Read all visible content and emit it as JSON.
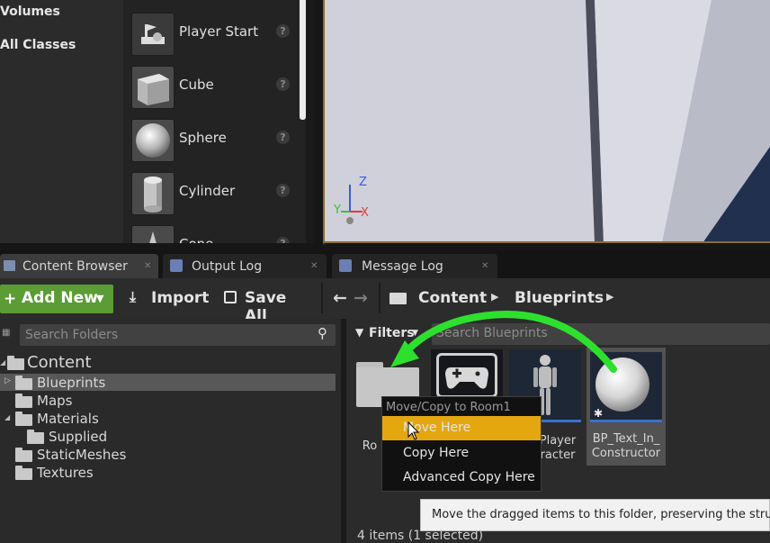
{
  "place_actors": {
    "categories": [
      "Volumes",
      "All Classes"
    ],
    "items": [
      {
        "label": "Player Start",
        "icon": "player-start-icon"
      },
      {
        "label": "Cube",
        "icon": "cube-icon"
      },
      {
        "label": "Sphere",
        "icon": "sphere-icon"
      },
      {
        "label": "Cylinder",
        "icon": "cylinder-icon"
      },
      {
        "label": "Cone",
        "icon": "cone-icon"
      }
    ],
    "help_glyph": "?"
  },
  "viewport": {
    "axis_z": "Z",
    "axis_y": "Y",
    "axis_x": "X"
  },
  "tabs": [
    {
      "label": "Content Browser",
      "icon": "content-browser-icon"
    },
    {
      "label": "Output Log",
      "icon": "output-log-icon"
    },
    {
      "label": "Message Log",
      "icon": "message-log-icon"
    }
  ],
  "toolbar": {
    "add_new_label": "Add New",
    "import_label": "Import",
    "save_all_label": "Save All",
    "breadcrumbs": [
      "Content",
      "Blueprints"
    ]
  },
  "folders": {
    "search_placeholder": "Search Folders",
    "root": "Content",
    "items": [
      "Blueprints",
      "Maps",
      "Materials",
      "Supplied",
      "StaticMeshes",
      "Textures"
    ],
    "selected": "Blueprints"
  },
  "assets": {
    "filters_label": "Filters",
    "search_placeholder": "Search Blueprints",
    "items": [
      {
        "label": "Ro",
        "kind": "folder"
      },
      {
        "label": "",
        "kind": "gamemode"
      },
      {
        "label": "Player\nracter",
        "kind": "character"
      },
      {
        "label": "BP_Text_In_\nConstructor",
        "kind": "sphere-blueprint"
      }
    ],
    "status": "4 items (1 selected)"
  },
  "context_menu": {
    "title": "Move/Copy to Room1",
    "items": [
      "Move Here",
      "Copy Here",
      "Advanced Copy Here"
    ],
    "highlighted": "Move Here"
  },
  "tooltip": "Move the dragged items to this folder, preserving the stru",
  "colors": {
    "add_new_green": "#5b9c35",
    "menu_highlight": "#e4a70f",
    "drag_arrow": "#2ee02e",
    "selection_outline": "#e8b12a"
  }
}
